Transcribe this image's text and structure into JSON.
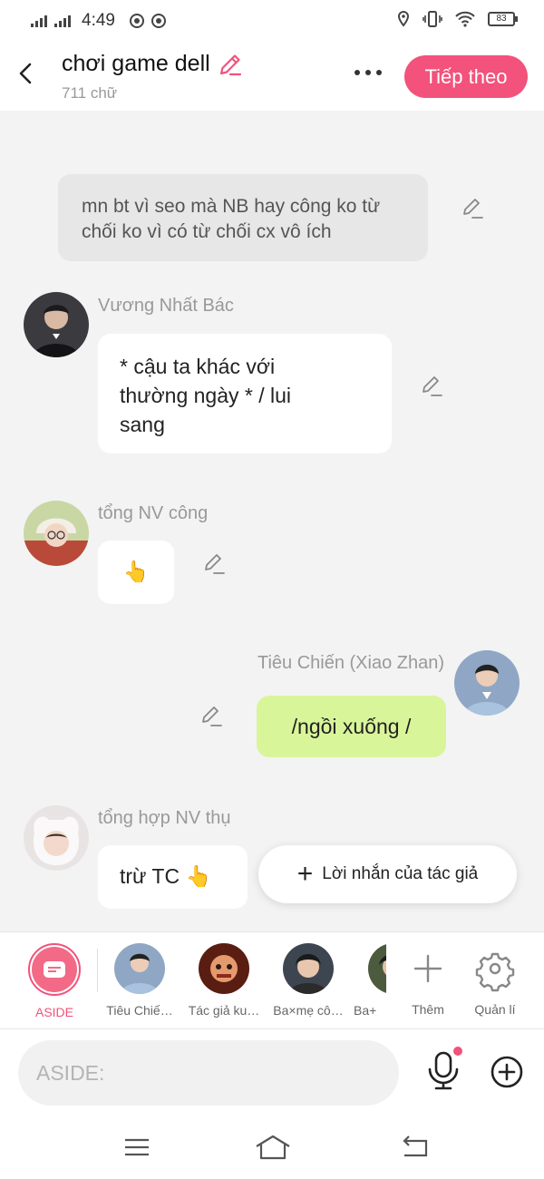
{
  "status": {
    "time": "4:49",
    "battery": "83"
  },
  "header": {
    "title": "chơi game dell",
    "word_count": "711 chữ",
    "next_label": "Tiếp theo"
  },
  "messages": [
    {
      "type": "aside",
      "text": "mn bt vì seo mà NB hay công ko từ chối ko vì có từ chối cx vô ích"
    },
    {
      "type": "left",
      "speaker": "Vương Nhất Bác",
      "lines": [
        "* cậu ta khác với",
        "thường ngày * / lui",
        "sang"
      ]
    },
    {
      "type": "left",
      "speaker": "tổng NV công",
      "text": "👆"
    },
    {
      "type": "right",
      "speaker": "Tiêu Chiến (Xiao Zhan)",
      "text": "/ngồi xuống /"
    },
    {
      "type": "left",
      "speaker": "tổng hợp NV thụ",
      "text": "trừ TC 👆"
    }
  ],
  "author_note_label": "Lời nhắn của tác giả",
  "characters": [
    {
      "label": "ASIDE",
      "selected": true
    },
    {
      "label": "Tiêu Chiế…"
    },
    {
      "label": "Tác giả ku…"
    },
    {
      "label": "Ba×mẹ cô…"
    },
    {
      "label": "Ba+"
    }
  ],
  "char_actions": {
    "add": "Thêm",
    "manage": "Quản lí"
  },
  "input": {
    "placeholder": "ASIDE:"
  },
  "colors": {
    "accent": "#f2527b",
    "green_bubble": "#d9f59a",
    "aside_bubble": "#e7e7e7"
  }
}
